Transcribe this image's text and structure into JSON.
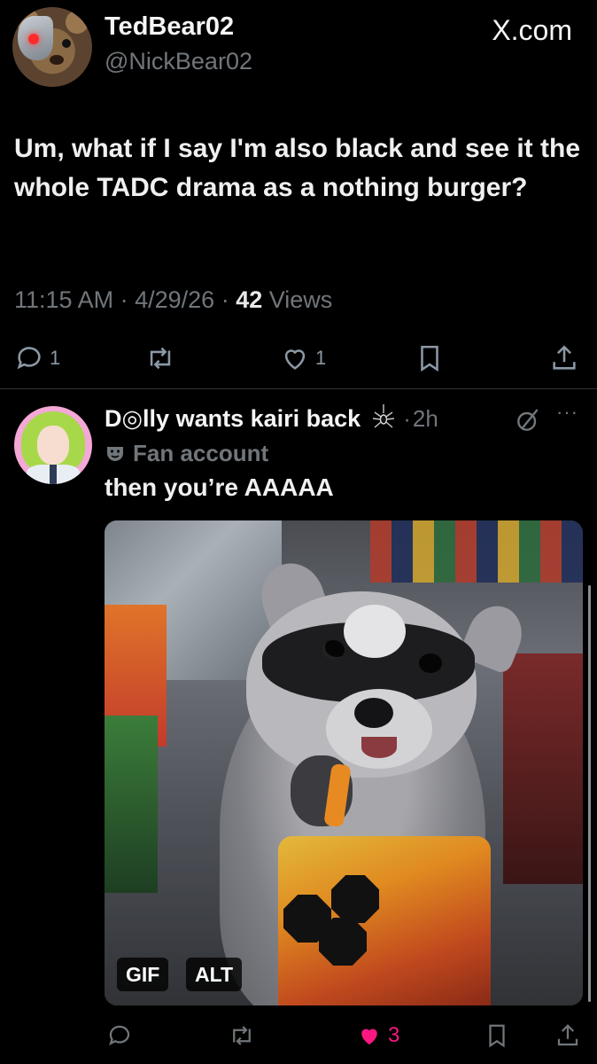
{
  "main_tweet": {
    "display_name": "TedBear02",
    "handle": "@NickBear02",
    "source_label": "X.com",
    "text": "Um, what if I say I'm also black and see it the whole TADC drama as a nothing burger?",
    "time": "11:15 AM",
    "date": "4/29/26",
    "views_count": "42",
    "views_label": "Views",
    "reply_count": "1",
    "like_count": "1"
  },
  "reply": {
    "display_name": "D◎lly wants kairi back",
    "time_ago": "2h",
    "label": "Fan account",
    "text": "then you’re AAAAA",
    "media": {
      "gif_badge": "GIF",
      "alt_badge": "ALT"
    },
    "like_count": "3"
  },
  "colors": {
    "background": "#000000",
    "secondary_text": "#71767b",
    "like_pink": "#f91880",
    "divider": "#2f3336"
  },
  "icons": [
    "reply-icon",
    "retweet-icon",
    "heart-icon",
    "bookmark-icon",
    "share-icon",
    "spider-icon",
    "grok-icon",
    "more-icon",
    "fan-mask-icon"
  ]
}
